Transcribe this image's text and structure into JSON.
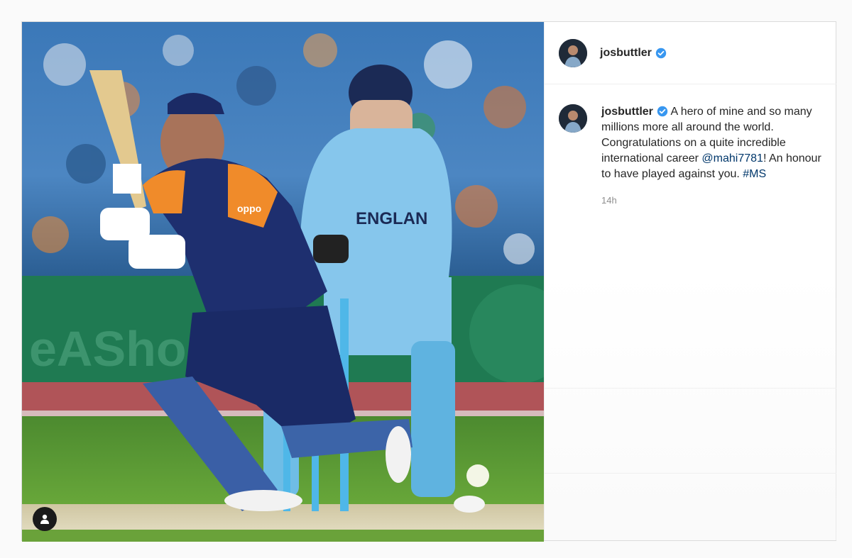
{
  "post": {
    "author": {
      "username": "josbuttler",
      "verified": true
    },
    "caption": {
      "username": "josbuttler",
      "text_before_mention": " A hero of mine and so many millions more all around the world. Congratulations on a quite incredible international career ",
      "mention": "@mahi7781",
      "text_after_mention": "! An honour to have played against you. ",
      "hashtag": "#MS"
    },
    "timestamp": "14h",
    "media": {
      "shirt_text_player1": "oppo",
      "shirt_text_player2": "ENGLAN"
    }
  },
  "colors": {
    "verified_badge": "#3897f0",
    "link": "#00376b",
    "muted": "#8e8e8e"
  },
  "icons": {
    "tag_user": "user-tag-icon",
    "verified": "verified-badge-icon"
  }
}
